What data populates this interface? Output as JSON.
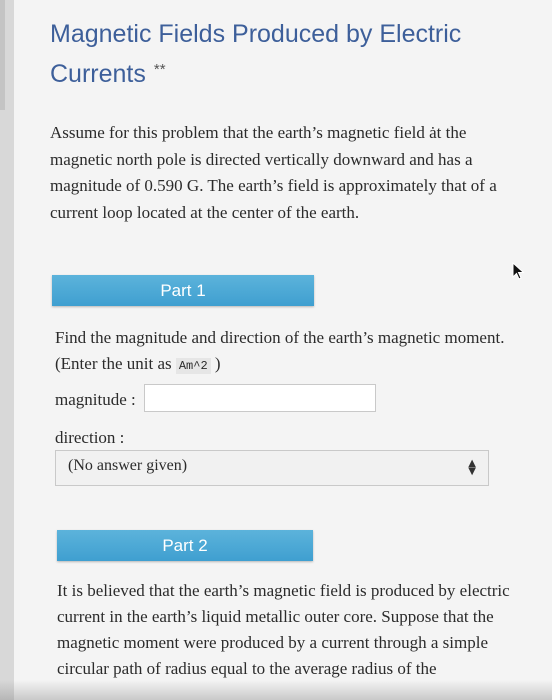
{
  "header": {
    "title": "Magnetic Fields Produced by Electric Currents",
    "difficulty": "**"
  },
  "intro": {
    "text": "Assume for this problem that the earth’s magnetic field ȧt the magnetic north pole is directed vertically downward and has a magnitude of 0.590 G. The earth’s field is approximately that of a current loop located at the center of the earth."
  },
  "part1": {
    "label": "Part 1",
    "question": "Find the magnitude and direction of the earth’s magnetic moment. (Enter the unit as",
    "unit_code": "Am^2",
    "question_end": ")",
    "magnitude_label": "magnitude :",
    "magnitude_value": "",
    "direction_label": "direction :",
    "direction_selected": "(No answer given)"
  },
  "part2": {
    "label": "Part 2",
    "text": "It is believed that the earth’s magnetic field is produced by electric current in the earth’s liquid metallic outer core. Suppose that the magnetic moment were produced by a current through a simple circular path of radius equal to the average radius of the"
  },
  "icons": {
    "cursor": "mouse-pointer-icon",
    "select_arrows": "sort-arrows-icon"
  },
  "colors": {
    "title": "#3d5f9a",
    "part_banner": "#4aa8d6"
  }
}
